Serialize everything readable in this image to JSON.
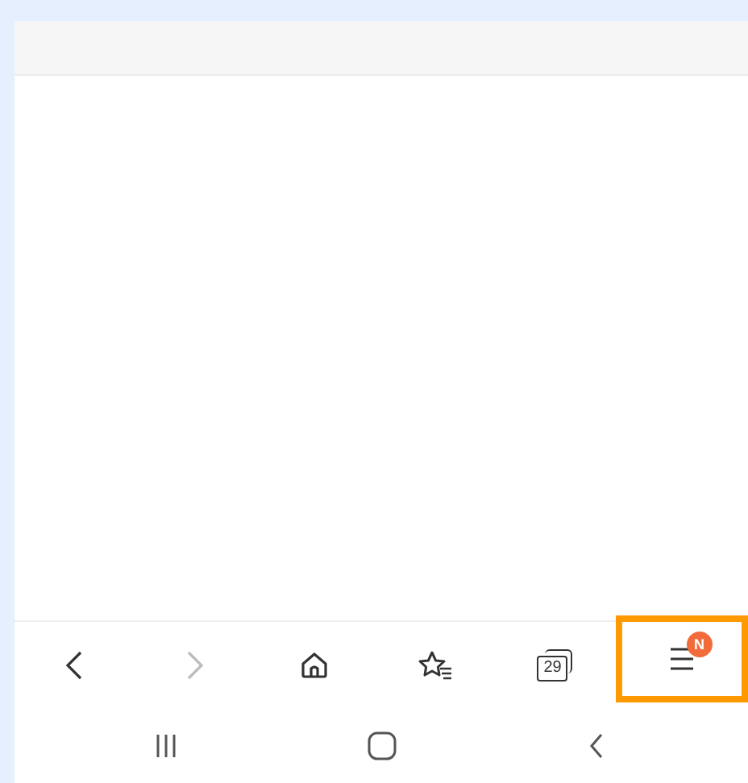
{
  "toolbar": [
    {
      "kind": "back",
      "disabled": false,
      "highlighted": false
    },
    {
      "kind": "forward",
      "disabled": true,
      "highlighted": false
    },
    {
      "kind": "home",
      "disabled": false,
      "highlighted": false
    },
    {
      "kind": "bookmarks",
      "disabled": false,
      "highlighted": false
    },
    {
      "kind": "tabs",
      "count": "29",
      "disabled": false,
      "highlighted": false
    },
    {
      "kind": "menu",
      "badge": "N",
      "disabled": false,
      "highlighted": true
    }
  ],
  "nav_bar": [
    {
      "kind": "recents"
    },
    {
      "kind": "home"
    },
    {
      "kind": "back"
    }
  ]
}
